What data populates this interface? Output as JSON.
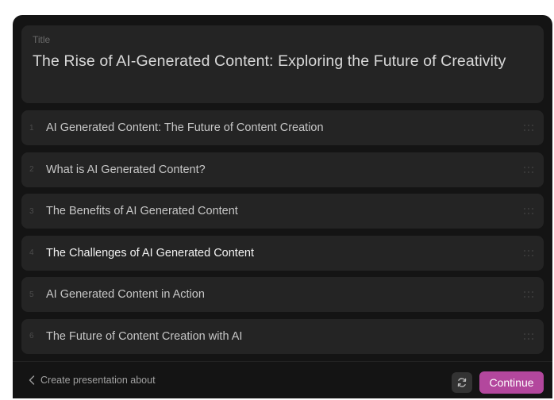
{
  "title_card": {
    "caption": "Title",
    "text": "The Rise of AI-Generated Content: Exploring the Future of Creativity"
  },
  "outline": {
    "items": [
      {
        "number": "1",
        "label": "AI Generated Content: The Future of Content Creation"
      },
      {
        "number": "2",
        "label": "What is AI Generated Content?"
      },
      {
        "number": "3",
        "label": "The Benefits of AI Generated Content"
      },
      {
        "number": "4",
        "label": "The Challenges of AI Generated Content",
        "active": true
      },
      {
        "number": "5",
        "label": "AI Generated Content in Action"
      },
      {
        "number": "6",
        "label": "The Future of Content Creation with AI"
      }
    ]
  },
  "footer": {
    "back_label": "Create presentation about",
    "continue_label": "Continue"
  },
  "icons": {
    "drag": "drag-handle-icon",
    "back": "chevron-left-icon",
    "refresh": "refresh-icon"
  },
  "colors": {
    "background": "#141414",
    "card": "#242424",
    "accent": "#b3479d"
  }
}
